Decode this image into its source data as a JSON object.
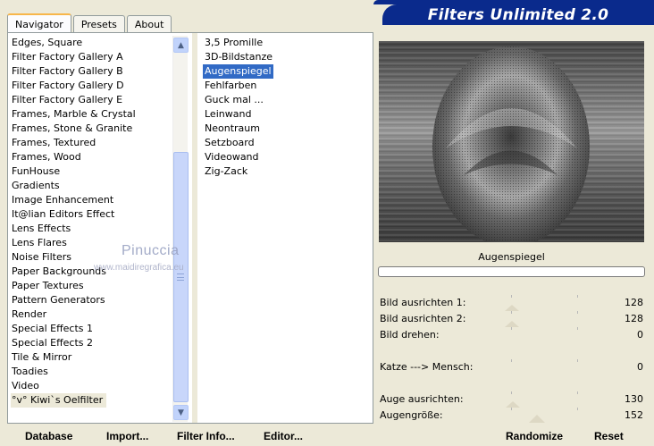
{
  "tabs": [
    {
      "label": "Navigator",
      "active": true
    },
    {
      "label": "Presets",
      "active": false
    },
    {
      "label": "About",
      "active": false
    }
  ],
  "title": "Filters Unlimited 2.0",
  "categories": [
    "Edges, Square",
    "Filter Factory Gallery A",
    "Filter Factory Gallery B",
    "Filter Factory Gallery D",
    "Filter Factory Gallery E",
    "Frames, Marble & Crystal",
    "Frames, Stone & Granite",
    "Frames, Textured",
    "Frames, Wood",
    "FunHouse",
    "Gradients",
    "Image Enhancement",
    "It@lian Editors Effect",
    "Lens Effects",
    "Lens Flares",
    "Noise Filters",
    "Paper Backgrounds",
    "Paper Textures",
    "Pattern Generators",
    "Render",
    "Special Effects 1",
    "Special Effects 2",
    "Tile & Mirror",
    "Toadies",
    "Video",
    "°v° Kiwi`s Oelfilter"
  ],
  "selected_category": "°v° Kiwi`s Oelfilter",
  "filters": [
    "3,5 Promille",
    "3D-Bildstanze",
    "Augenspiegel",
    "Fehlfarben",
    "Guck mal ...",
    "Leinwand",
    "Neontraum",
    "Setzboard",
    "Videowand",
    "Zig-Zack"
  ],
  "selected_filter": "Augenspiegel",
  "filter_name_display": "Augenspiegel",
  "progress": 0,
  "parameters": [
    {
      "label": "Bild ausrichten 1:",
      "value": "128",
      "level": 0.5
    },
    {
      "label": "Bild ausrichten 2:",
      "value": "128",
      "level": 0.5
    },
    {
      "label": "Bild drehen:",
      "value": "0",
      "level": 0
    },
    {
      "label": "Katze ---> Mensch:",
      "value": "0",
      "level": 0
    },
    {
      "label": "Auge ausrichten:",
      "value": "130",
      "level": 0.51
    },
    {
      "label": "Augengröße:",
      "value": "152",
      "level": 0.6
    }
  ],
  "bottom_buttons": {
    "database": "Database",
    "import": "Import...",
    "filter_info": "Filter Info...",
    "editor": "Editor...",
    "randomize": "Randomize",
    "reset": "Reset"
  },
  "watermark": {
    "line1": "Pinuccia",
    "line2": "www.maidiregrafica.eu"
  },
  "colors": {
    "banner": "#0a2a8c",
    "selection": "#316ac5",
    "window_bg": "#ece9d8"
  }
}
